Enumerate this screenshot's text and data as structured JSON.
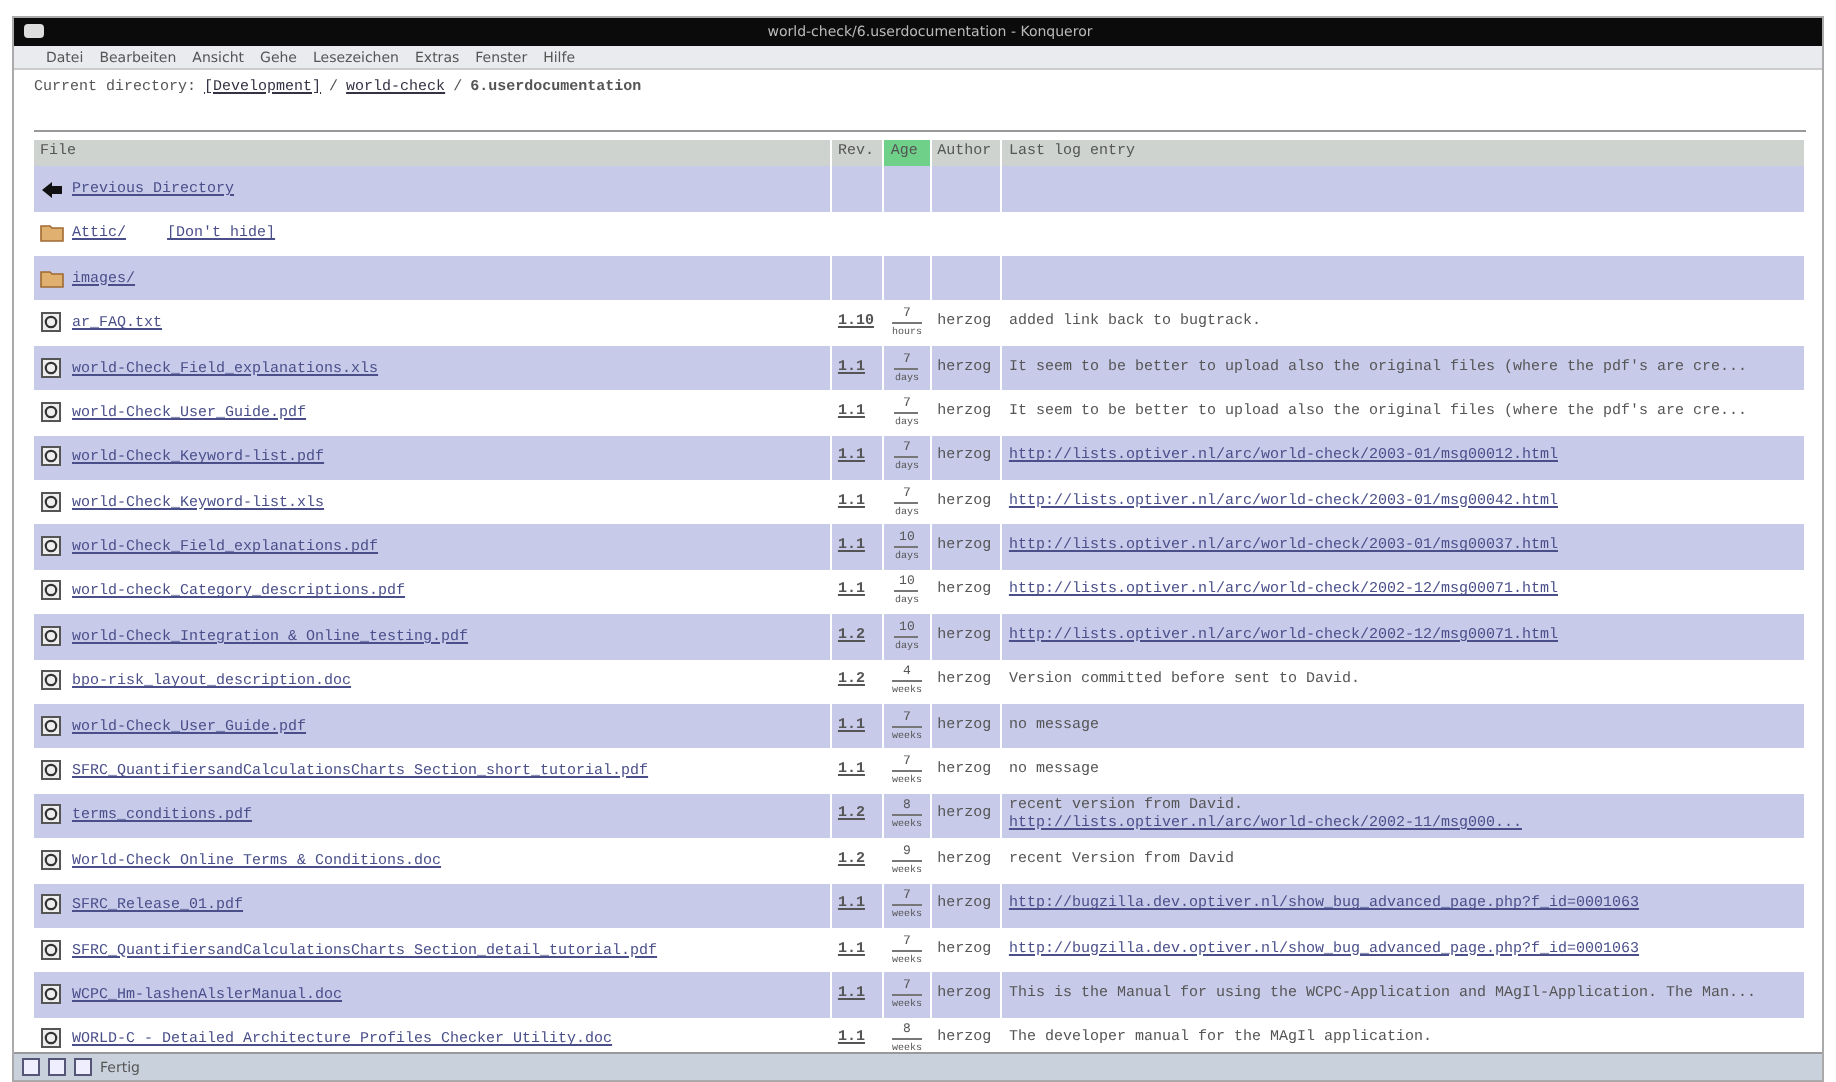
{
  "window": {
    "title": "world-check/6.userdocumentation - Konqueror"
  },
  "menu": [
    "Datei",
    "Bearbeiten",
    "Ansicht",
    "Gehe",
    "Lesezeichen",
    "Extras",
    "Fenster",
    "Hilfe"
  ],
  "location": {
    "label": "Current directory:",
    "parts": [
      {
        "kind": "link",
        "text": "[Development]"
      },
      {
        "kind": "sep",
        "text": "/"
      },
      {
        "kind": "link",
        "text": "world-check"
      },
      {
        "kind": "sep",
        "text": "/"
      },
      {
        "kind": "current",
        "text": "6.userdocumentation"
      }
    ]
  },
  "table": {
    "columns": [
      {
        "label": "File",
        "sorted": false
      },
      {
        "label": "Rev.",
        "sorted": false
      },
      {
        "label": "Age",
        "sorted": true
      },
      {
        "label": "Author",
        "sorted": false
      },
      {
        "label": "Last log entry",
        "sorted": false
      }
    ],
    "rows": [
      {
        "kind": "parent",
        "name": "Previous Directory"
      },
      {
        "kind": "folder",
        "name": "Attic/",
        "extra": "[Don't hide]"
      },
      {
        "kind": "folder",
        "name": "images/"
      },
      {
        "kind": "file",
        "name": "ar_FAQ.txt",
        "rev": "1.10",
        "age": "7",
        "age_unit": "hours",
        "author": "herzog",
        "log": [
          {
            "kind": "text",
            "text": "added link back to bugtrack."
          }
        ]
      },
      {
        "kind": "file",
        "name": "world-Check_Field_explanations.xls",
        "rev": "1.1",
        "age": "7",
        "age_unit": "days",
        "author": "herzog",
        "log": [
          {
            "kind": "text",
            "text": "It seem to be better to upload also the original files (where the pdf's are cre..."
          }
        ]
      },
      {
        "kind": "file",
        "name": "world-Check_User_Guide.pdf",
        "rev": "1.1",
        "age": "7",
        "age_unit": "days",
        "author": "herzog",
        "log": [
          {
            "kind": "text",
            "text": "It seem to be better to upload also the original files (where the pdf's are cre..."
          }
        ]
      },
      {
        "kind": "file",
        "name": "world-Check_Keyword-list.pdf",
        "rev": "1.1",
        "age": "7",
        "age_unit": "days",
        "author": "herzog",
        "log": [
          {
            "kind": "link",
            "text": "http://lists.optiver.nl/arc/world-check/2003-01/msg00012.html"
          }
        ]
      },
      {
        "kind": "file",
        "name": "world-Check_Keyword-list.xls",
        "rev": "1.1",
        "age": "7",
        "age_unit": "days",
        "author": "herzog",
        "log": [
          {
            "kind": "link",
            "text": "http://lists.optiver.nl/arc/world-check/2003-01/msg00042.html"
          }
        ]
      },
      {
        "kind": "file",
        "name": "world-Check_Field_explanations.pdf",
        "rev": "1.1",
        "age": "10",
        "age_unit": "days",
        "author": "herzog",
        "log": [
          {
            "kind": "link",
            "text": "http://lists.optiver.nl/arc/world-check/2003-01/msg00037.html"
          }
        ]
      },
      {
        "kind": "file",
        "name": "world-check_Category_descriptions.pdf",
        "rev": "1.1",
        "age": "10",
        "age_unit": "days",
        "author": "herzog",
        "log": [
          {
            "kind": "link",
            "text": "http://lists.optiver.nl/arc/world-check/2002-12/msg00071.html"
          }
        ]
      },
      {
        "kind": "file",
        "name": "world-Check_Integration & Online_testing.pdf",
        "rev": "1.2",
        "age": "10",
        "age_unit": "days",
        "author": "herzog",
        "log": [
          {
            "kind": "link",
            "text": "http://lists.optiver.nl/arc/world-check/2002-12/msg00071.html"
          }
        ]
      },
      {
        "kind": "file",
        "name": "bpo-risk_layout_description.doc",
        "rev": "1.2",
        "age": "4",
        "age_unit": "weeks",
        "author": "herzog",
        "log": [
          {
            "kind": "text",
            "text": "Version committed before sent to David."
          }
        ]
      },
      {
        "kind": "file",
        "name": "world-Check_User_Guide.pdf",
        "rev": "1.1",
        "age": "7",
        "age_unit": "weeks",
        "author": "herzog",
        "log": [
          {
            "kind": "text",
            "text": "no message"
          }
        ]
      },
      {
        "kind": "file",
        "name": "SFRC_QuantifiersandCalculationsCharts Section_short_tutorial.pdf",
        "rev": "1.1",
        "age": "7",
        "age_unit": "weeks",
        "author": "herzog",
        "log": [
          {
            "kind": "text",
            "text": "no message"
          }
        ]
      },
      {
        "kind": "file",
        "name": "terms_conditions.pdf",
        "rev": "1.2",
        "age": "8",
        "age_unit": "weeks",
        "author": "herzog",
        "log": [
          {
            "kind": "text",
            "text": "recent version from David."
          },
          {
            "kind": "link",
            "text": "http://lists.optiver.nl/arc/world-check/2002-11/msg000..."
          }
        ]
      },
      {
        "kind": "file",
        "name": "World-Check Online Terms & Conditions.doc",
        "rev": "1.2",
        "age": "9",
        "age_unit": "weeks",
        "author": "herzog",
        "log": [
          {
            "kind": "text",
            "text": "recent Version from David"
          }
        ]
      },
      {
        "kind": "file",
        "name": "SFRC_Release_01.pdf",
        "rev": "1.1",
        "age": "7",
        "age_unit": "weeks",
        "author": "herzog",
        "log": [
          {
            "kind": "link",
            "text": "http://bugzilla.dev.optiver.nl/show_bug_advanced_page.php?f_id=0001063"
          }
        ]
      },
      {
        "kind": "file",
        "name": "SFRC_QuantifiersandCalculationsCharts Section_detail_tutorial.pdf",
        "rev": "1.1",
        "age": "7",
        "age_unit": "weeks",
        "author": "herzog",
        "log": [
          {
            "kind": "link",
            "text": "http://bugzilla.dev.optiver.nl/show_bug_advanced_page.php?f_id=0001063"
          }
        ]
      },
      {
        "kind": "file",
        "name": "WCPC_Hm-lashenAlslerManual.doc",
        "rev": "1.1",
        "age": "7",
        "age_unit": "weeks",
        "author": "herzog",
        "log": [
          {
            "kind": "text",
            "text": "This is the Manual for using the WCPC-Application and MAgIl-Application. The Man..."
          }
        ]
      },
      {
        "kind": "file",
        "name": "WORLD-C - Detailed Architecture Profiles Checker Utility.doc",
        "rev": "1.1",
        "age": "8",
        "age_unit": "weeks",
        "author": "herzog",
        "log": [
          {
            "kind": "text",
            "text": "The developer manual for the MAgIl application."
          }
        ]
      }
    ]
  },
  "status_bar": {
    "text": "Fertig"
  }
}
